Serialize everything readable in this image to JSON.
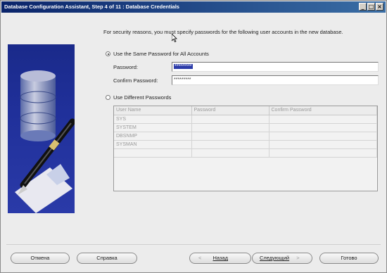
{
  "window": {
    "title": "Database Configuration Assistant, Step 4 of 11 : Database Credentials",
    "controls": [
      "_",
      "□",
      "×"
    ]
  },
  "intro_text": "For security reasons, you must specify passwords for the following user accounts in the new database.",
  "same_password": {
    "label": "Use the Same Password for All Accounts",
    "selected": true,
    "password_label": "Password:",
    "password_value": "*********",
    "confirm_label": "Confirm Password:",
    "confirm_value": "*********"
  },
  "different_passwords": {
    "label": "Use Different Passwords",
    "selected": false,
    "columns": [
      "User Name",
      "Password",
      "Confirm Password"
    ],
    "rows": [
      [
        "SYS",
        "",
        ""
      ],
      [
        "SYSTEM",
        "",
        ""
      ],
      [
        "DBSNMP",
        "",
        ""
      ],
      [
        "SYSMAN",
        "",
        ""
      ]
    ]
  },
  "footer": {
    "cancel": "Отмена",
    "help": "Справка",
    "back_arrow": "<",
    "back": "Назад",
    "next": "Следующий",
    "next_arrow": ">",
    "finish": "Готово"
  },
  "colors": {
    "titlebar": "#0a246a",
    "art_background": "#1a2a8a",
    "selection": "#2a3aa8"
  },
  "icons": [
    "database-pen-illustration",
    "mouse-cursor-icon"
  ]
}
